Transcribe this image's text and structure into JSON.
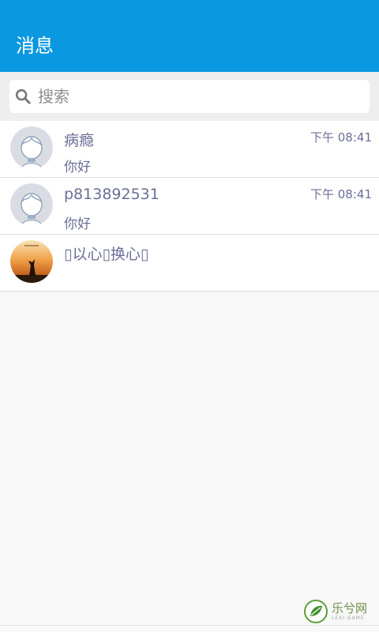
{
  "appbar": {
    "title": "消息",
    "color": "#0a98e0"
  },
  "search": {
    "placeholder": "搜索",
    "value": ""
  },
  "conversations": [
    {
      "name": "病瘾",
      "time": "下午 08:41",
      "message": "你好",
      "avatar": "default-avatar"
    },
    {
      "name": "p813892531",
      "time": "下午 08:41",
      "message": "你好",
      "avatar": "default-avatar"
    },
    {
      "name": "▯以心▯换心▯",
      "time": "",
      "message": "",
      "avatar": "sunset-photo-avatar"
    }
  ],
  "watermark": {
    "cn": "乐兮网",
    "en": "LEXI GAME"
  },
  "colors": {
    "text_secondary": "#6a6f96",
    "divider": "#dcdcdc",
    "background": "#f8f8f8"
  }
}
